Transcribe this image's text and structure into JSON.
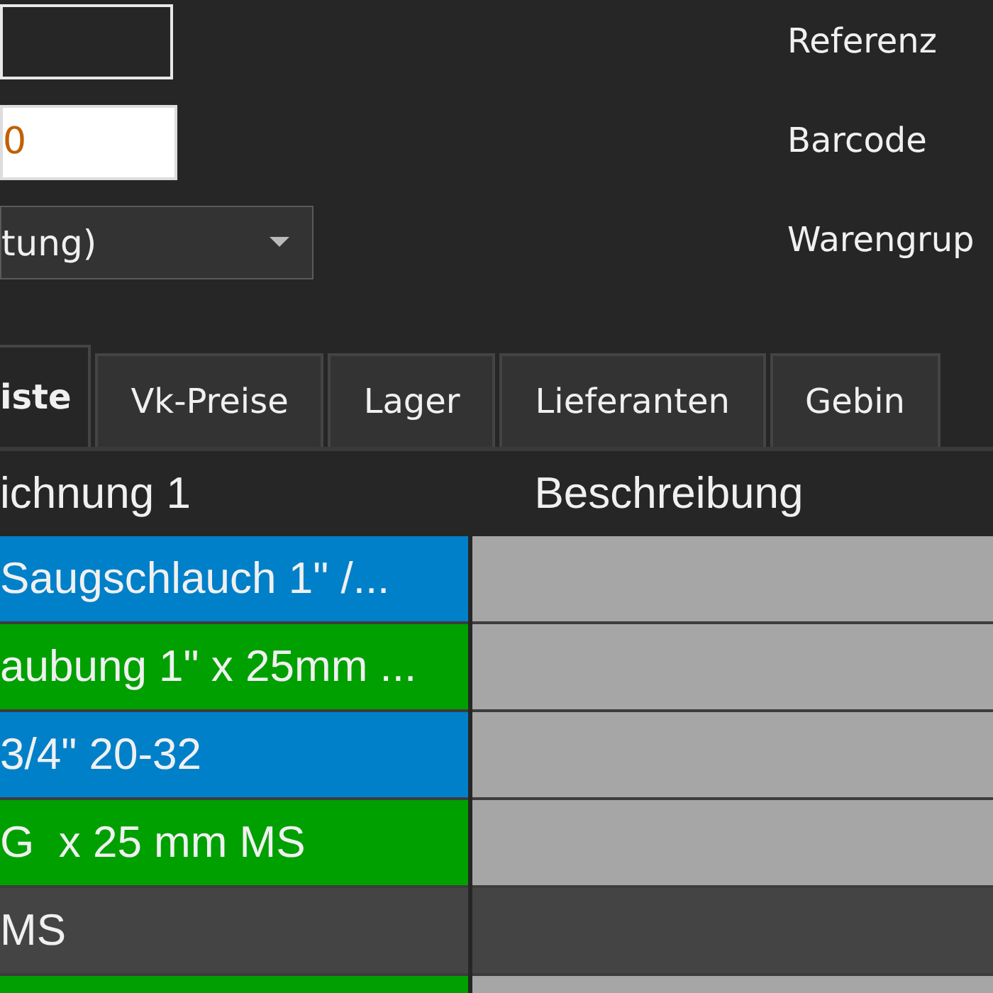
{
  "fields": [
    {
      "kind": "text"
    },
    {
      "kind": "text",
      "value": "0"
    },
    {
      "kind": "dropdown",
      "value": "tung)"
    }
  ],
  "labels": [
    "Referenz",
    "Barcode",
    "Warengrup"
  ],
  "tabs": [
    {
      "label": "iste",
      "selected": true
    },
    {
      "label": "Vk-Preise",
      "selected": false
    },
    {
      "label": "Lager",
      "selected": false
    },
    {
      "label": "Lieferanten",
      "selected": false
    },
    {
      "label": "Gebin",
      "selected": false
    }
  ],
  "table": {
    "columns": [
      "ichnung 1",
      "Beschreibung"
    ],
    "rows": [
      {
        "name": "Saugschlauch 1\" /...",
        "color": "#0080c8",
        "selected": false
      },
      {
        "name": "aubung 1\" x 25mm ...",
        "color": "#00a000",
        "selected": false
      },
      {
        "name": "3/4\" 20-32",
        "color": "#0080c8",
        "selected": false
      },
      {
        "name": "G  x 25 mm MS",
        "color": "#00a000",
        "selected": false
      },
      {
        "name": "MS",
        "color": "#444444",
        "selected": true
      },
      {
        "color": "#00a000",
        "selected": false
      }
    ]
  }
}
